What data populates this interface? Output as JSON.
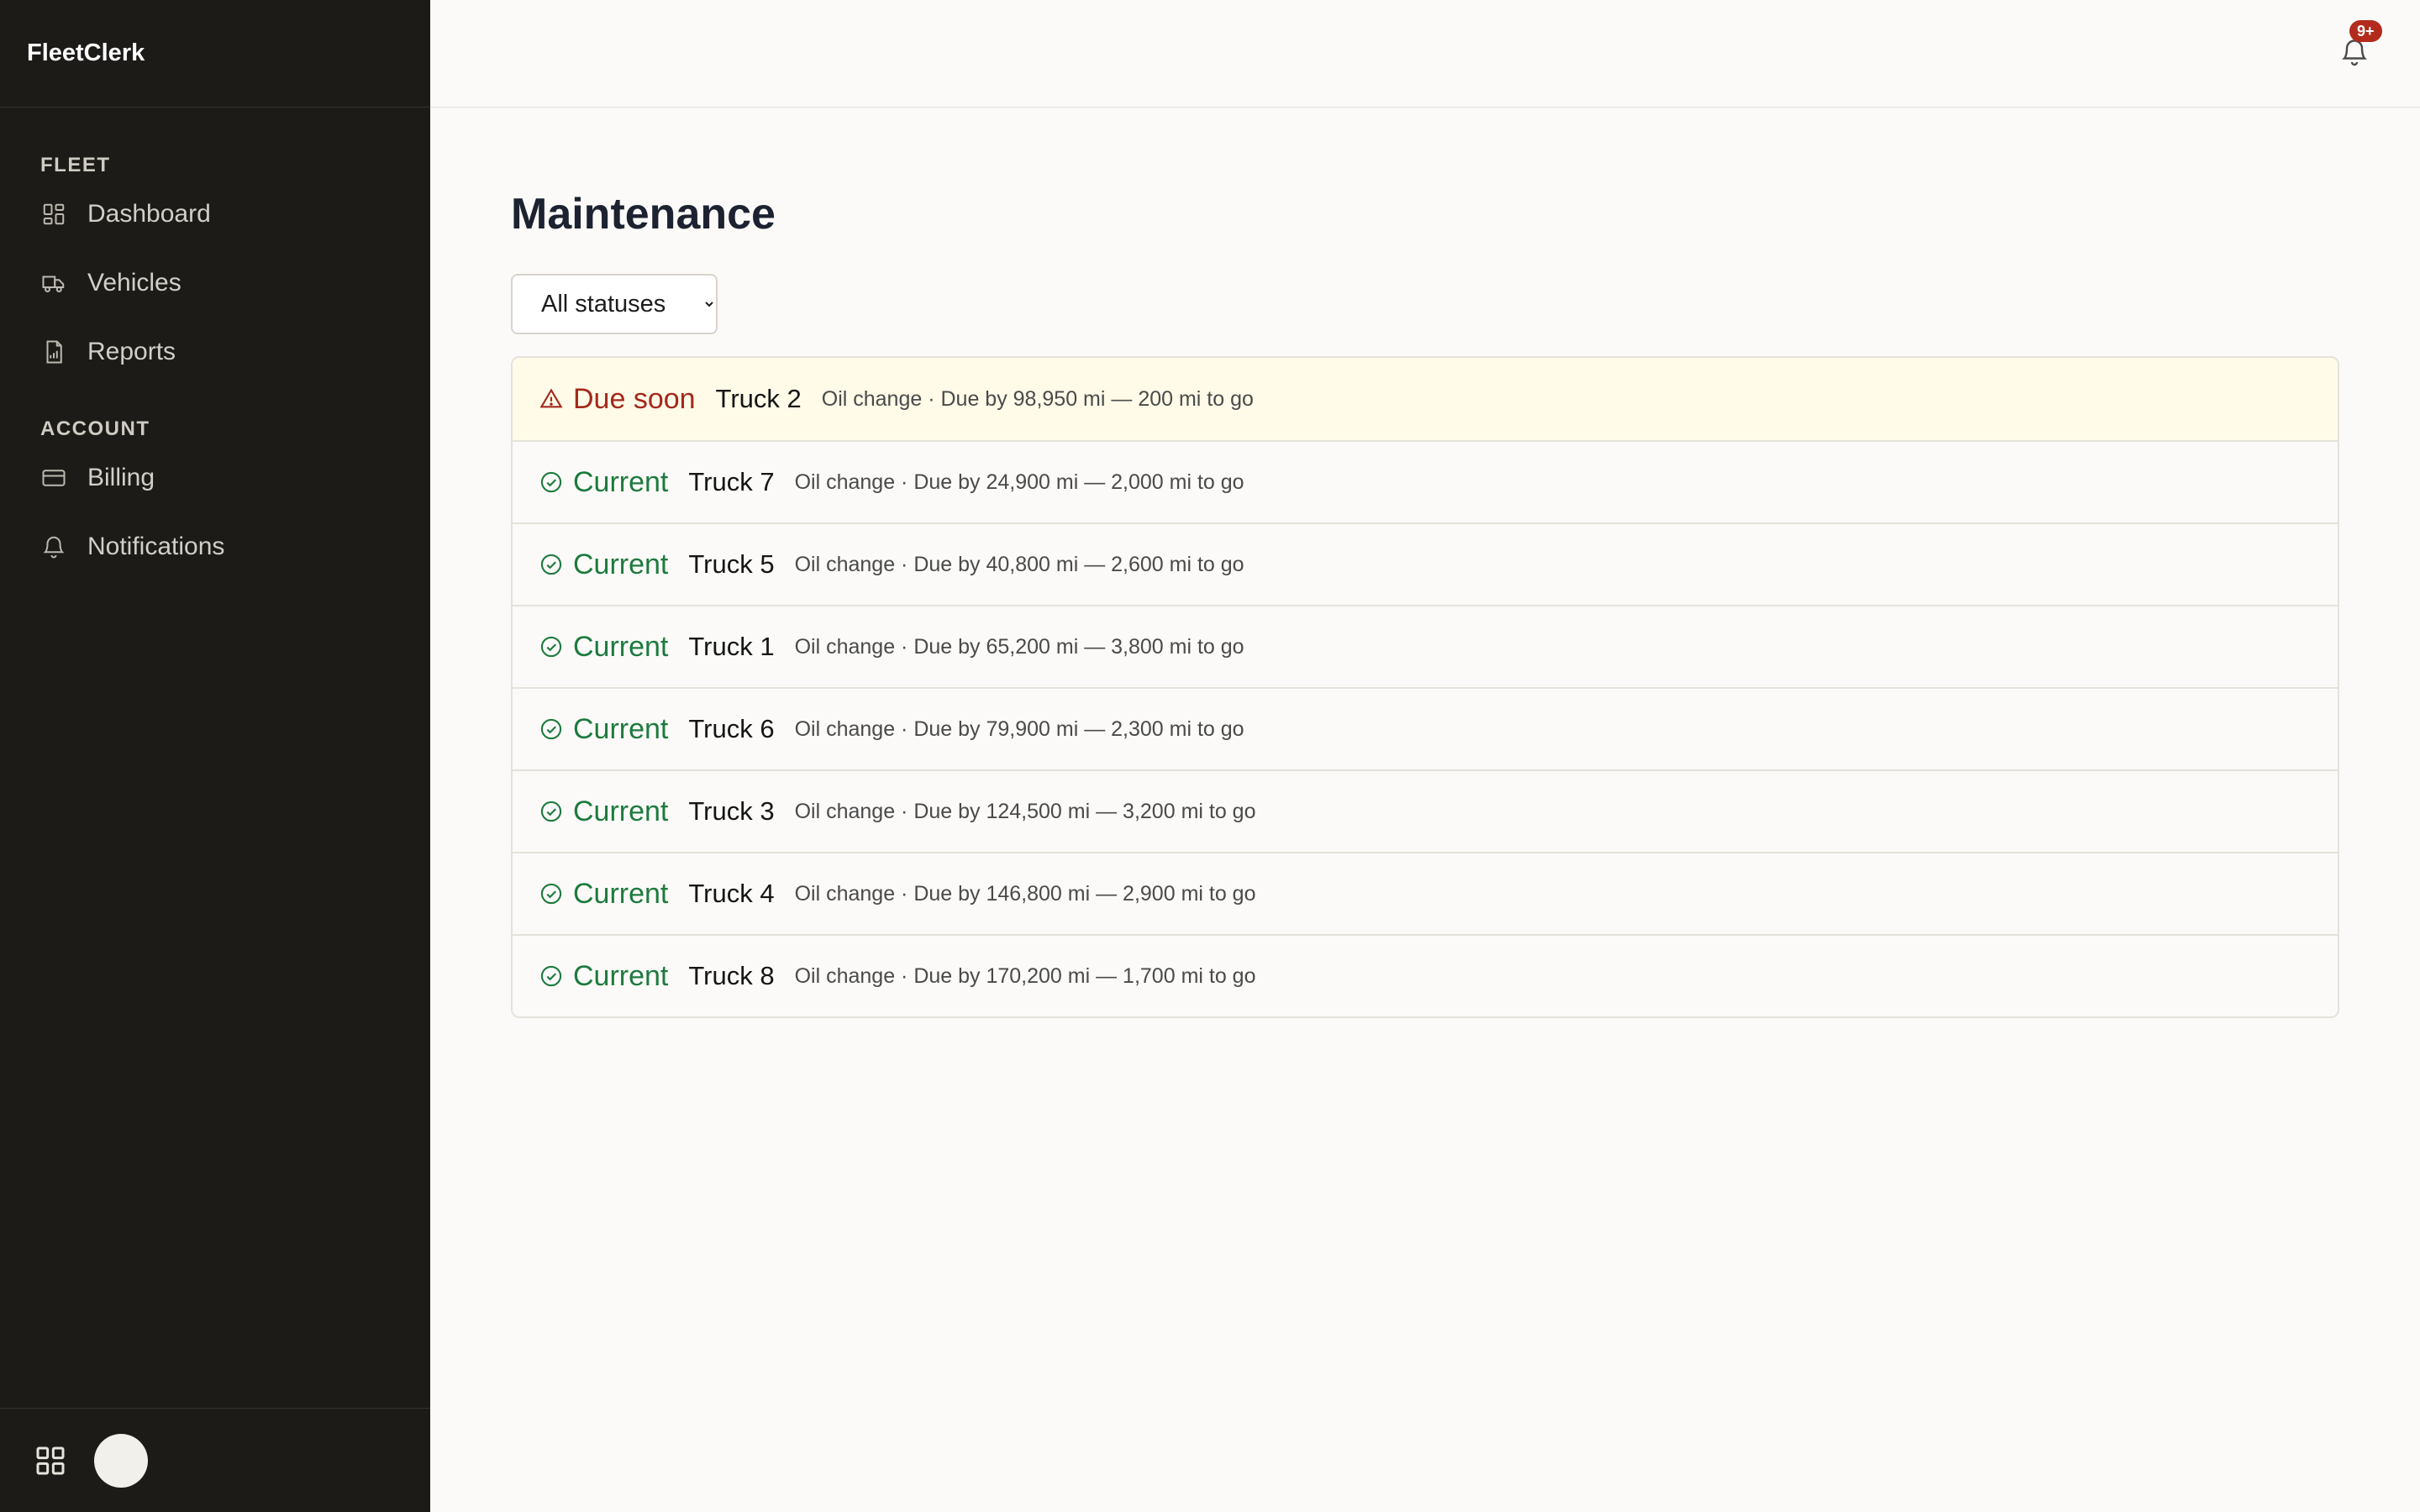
{
  "app": {
    "name": "FleetClerk"
  },
  "sidebar": {
    "sections": [
      {
        "title": "FLEET",
        "items": [
          {
            "label": "Dashboard",
            "icon": "dashboard-icon"
          },
          {
            "label": "Vehicles",
            "icon": "truck-icon"
          },
          {
            "label": "Reports",
            "icon": "report-icon"
          }
        ]
      },
      {
        "title": "ACCOUNT",
        "items": [
          {
            "label": "Billing",
            "icon": "credit-card-icon"
          },
          {
            "label": "Notifications",
            "icon": "bell-icon"
          }
        ]
      }
    ]
  },
  "topbar": {
    "notification_badge": "9+"
  },
  "main": {
    "title": "Maintenance",
    "filter": {
      "selected": "All statuses",
      "options": [
        "All statuses"
      ]
    },
    "rows": [
      {
        "status": "Due soon",
        "state": "warn",
        "vehicle": "Truck 2",
        "detail": "Oil change · Due by 98,950 mi — 200 mi to go"
      },
      {
        "status": "Current",
        "state": "ok",
        "vehicle": "Truck 7",
        "detail": "Oil change · Due by 24,900 mi — 2,000 mi to go"
      },
      {
        "status": "Current",
        "state": "ok",
        "vehicle": "Truck 5",
        "detail": "Oil change · Due by 40,800 mi — 2,600 mi to go"
      },
      {
        "status": "Current",
        "state": "ok",
        "vehicle": "Truck 1",
        "detail": "Oil change · Due by 65,200 mi — 3,800 mi to go"
      },
      {
        "status": "Current",
        "state": "ok",
        "vehicle": "Truck 6",
        "detail": "Oil change · Due by 79,900 mi — 2,300 mi to go"
      },
      {
        "status": "Current",
        "state": "ok",
        "vehicle": "Truck 3",
        "detail": "Oil change · Due by 124,500 mi — 3,200 mi to go"
      },
      {
        "status": "Current",
        "state": "ok",
        "vehicle": "Truck 4",
        "detail": "Oil change · Due by 146,800 mi — 2,900 mi to go"
      },
      {
        "status": "Current",
        "state": "ok",
        "vehicle": "Truck 8",
        "detail": "Oil change · Due by 170,200 mi — 1,700 mi to go"
      }
    ]
  },
  "colors": {
    "sidebar_bg": "#1c1b18",
    "page_bg": "#fbfaf8",
    "ok": "#1d7a3e",
    "warn": "#a3281b",
    "warn_row_bg": "#fffbe8",
    "badge": "#b32b1d"
  }
}
